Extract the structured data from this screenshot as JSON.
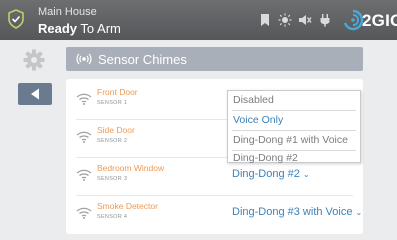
{
  "status": {
    "location": "Main House",
    "state_strong": "Ready",
    "state_rest": "To Arm"
  },
  "brand": {
    "name": "2GIG"
  },
  "section": {
    "title": "Sensor Chimes"
  },
  "sensors": [
    {
      "name": "Front Door",
      "number": "SENSOR 1",
      "chime": ""
    },
    {
      "name": "Side Door",
      "number": "SENSOR 2",
      "chime": ""
    },
    {
      "name": "Bedroom Window",
      "number": "SENSOR 3",
      "chime": "Ding-Dong #2"
    },
    {
      "name": "Smoke Detector",
      "number": "SENSOR 4",
      "chime": "Ding-Dong #3 with Voice"
    }
  ],
  "dropdown": {
    "options": [
      "Disabled",
      "Voice Only",
      "Ding-Dong #1 with Voice",
      "Ding-Dong #2"
    ],
    "selected": "Voice Only"
  },
  "colors": {
    "accent": "#3c82b8",
    "sensor_name": "#ee9a55",
    "topbar": "#5f6164"
  },
  "icons": [
    "shield-check-icon",
    "bookmark-icon",
    "sun-icon",
    "mute-icon",
    "plug-icon",
    "gear-icon",
    "back-arrow-icon",
    "wireless-icon"
  ]
}
